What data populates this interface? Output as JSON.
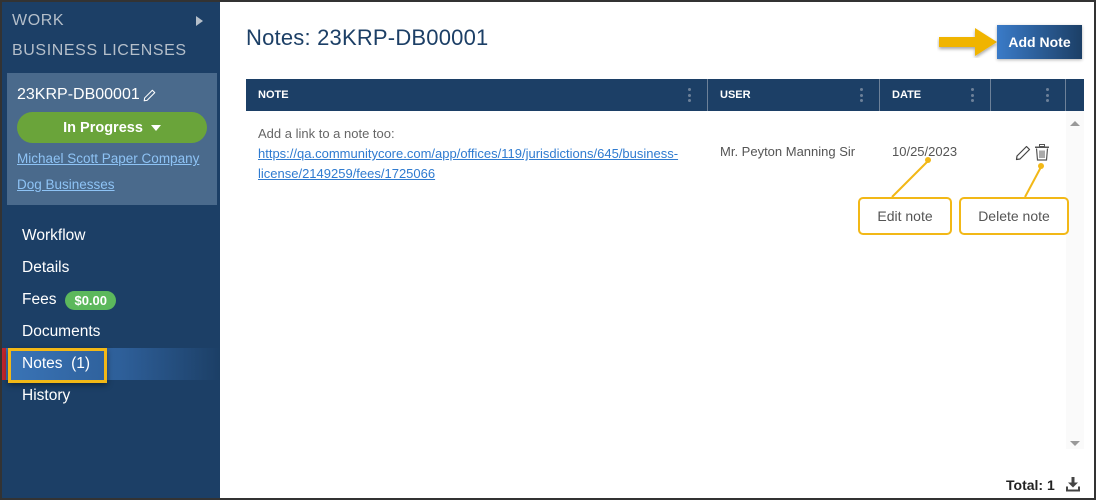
{
  "sidebar": {
    "section_label": "WORK",
    "module_label": "BUSINESS LICENSES",
    "record": {
      "id": "23KRP-DB00001",
      "status": "In Progress",
      "links": [
        "Michael Scott Paper Company",
        "Dog Businesses"
      ]
    },
    "nav": [
      {
        "label": "Workflow"
      },
      {
        "label": "Details"
      },
      {
        "label": "Fees",
        "badge": "$0.00"
      },
      {
        "label": "Documents"
      },
      {
        "label": "Notes  (1)",
        "active": true
      },
      {
        "label": "History"
      }
    ]
  },
  "main": {
    "title": "Notes: 23KRP-DB00001",
    "add_button": "Add Note",
    "columns": [
      "NOTE",
      "USER",
      "DATE",
      ""
    ],
    "rows": [
      {
        "note_text": "Add a link to a note too:",
        "note_link": "https://qa.communitycore.com/app/offices/119/jurisdictions/645/business-license/2149259/fees/1725066",
        "user": "Mr. Peyton Manning Sir",
        "date": "10/25/2023"
      }
    ],
    "callouts": {
      "edit": "Edit note",
      "delete": "Delete note"
    },
    "total": "Total: 1"
  },
  "colors": {
    "sidebar_bg": "#1c3f66",
    "status_green": "#6aa43a",
    "badge_green": "#5cb85c",
    "highlight_yellow": "#f2b817",
    "link_blue": "#2f7bd0",
    "active_marker": "#c0262d"
  }
}
